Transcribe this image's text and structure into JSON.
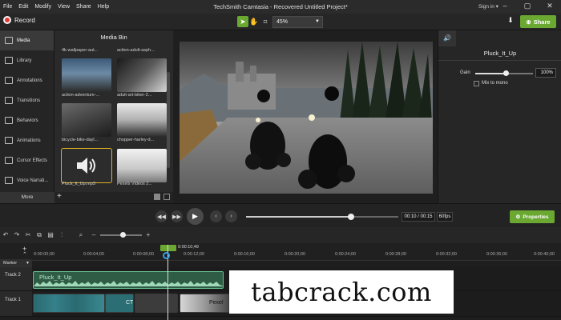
{
  "menu": {
    "items": [
      "File",
      "Edit",
      "Modify",
      "View",
      "Share",
      "Help"
    ],
    "title": "TechSmith Camtasia - Recovered  Untitled Project*",
    "signin": "Sign in ▾"
  },
  "toolbar": {
    "record_label": "Record",
    "zoom": "45%",
    "share_label": "Share"
  },
  "leftnav": {
    "items": [
      "Media",
      "Library",
      "Annotations",
      "Transitions",
      "Behaviors",
      "Animations",
      "Cursor Effects",
      "Voice Narrati..."
    ],
    "more": "More"
  },
  "mediabin": {
    "title": "Media Bin",
    "items": [
      {
        "label": "4k-wallpaper-aut..."
      },
      {
        "label": "action-adult-asph..."
      },
      {
        "label": "action-adventure-..."
      },
      {
        "label": "adult-art-biker-2..."
      },
      {
        "label": "bicycle-bike-dayl..."
      },
      {
        "label": "chopper-harley-d..."
      },
      {
        "label": "Pluck_It_Up.mp3"
      },
      {
        "label": "Pexels Videos 2..."
      }
    ]
  },
  "properties": {
    "title": "Pluck_It_Up",
    "gain_label": "Gain",
    "gain_value": "100%",
    "gain_level": 0.5,
    "mono_label": "Mix to mono",
    "button_label": "Properties"
  },
  "playback": {
    "timecode": "00:10 / 00:15",
    "fps": "60fps",
    "progress": 0.67
  },
  "timeline": {
    "playhead_time": "0:00:10;49",
    "ruler": [
      "0:00:00;00",
      "0:00:04;00",
      "0:00:08;00",
      "0:00:12;00",
      "0:00:16;00",
      "0:00:20;00",
      "0:00:24;00",
      "0:00:28;00",
      "0:00:32;00",
      "0:00:36;00",
      "0:00:40;00"
    ],
    "marker_label": "Marker",
    "tracks": [
      {
        "name": "Track 2"
      },
      {
        "name": "Track 1"
      }
    ],
    "audio_clip_label": "Pluck_It_Up",
    "video_clip_labels": [
      "CT",
      "Pexel"
    ]
  },
  "watermark": "tabcrack.com"
}
